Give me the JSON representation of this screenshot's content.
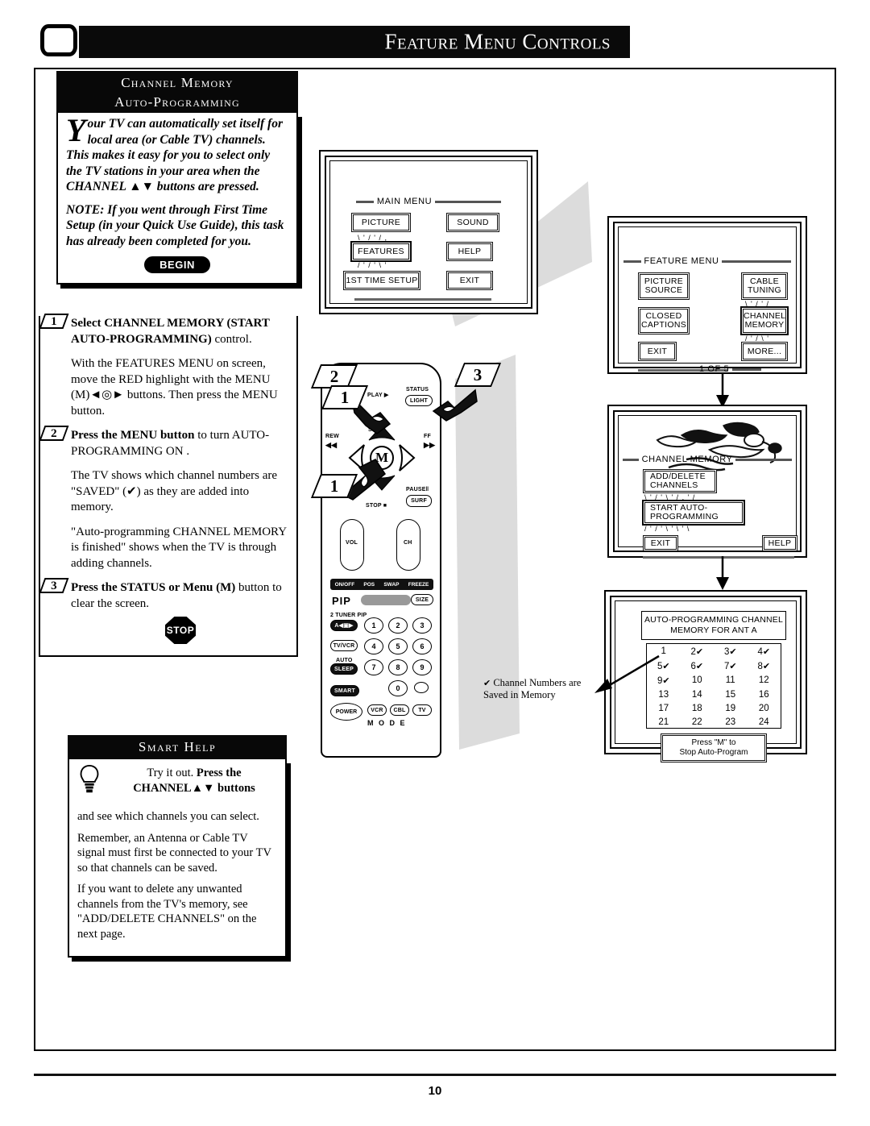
{
  "page": {
    "number": "10",
    "header_title": "Feature Menu Controls",
    "tv_icon": "tv-screen-icon"
  },
  "channel_memory_panel": {
    "heading_line1": "Channel Memory",
    "heading_line2": "Auto-Programming",
    "dropcap": "Y",
    "intro_paragraph": "our TV can automatically set itself for local area (or Cable TV) channels. This makes it easy for you to select only the TV stations in your area when the CHANNEL ▲▼ buttons are pressed.",
    "note_paragraph": "NOTE: If you went through First Time Setup (in your Quick Use Guide), this task has already been completed for you.",
    "begin_badge": "BEGIN"
  },
  "steps": [
    {
      "number": "1",
      "bold_text": "Select CHANNEL MEMORY (START AUTO-PROGRAMMING)",
      "rest_text": " control."
    },
    {
      "number": "2",
      "bold_text": "Press the MENU button",
      "rest_text": " to turn AUTO-PROGRAMMING ON ."
    },
    {
      "number": "3",
      "bold_text": "Press the STATUS or Menu (M)",
      "rest_text": " button to clear the screen."
    }
  ],
  "step_body": {
    "after_step1": "With the FEATURES MENU on screen, move the RED highlight  with the MENU (M)◄◎► buttons. Then press the MENU button.",
    "after_step2_a": "The TV shows which channel numbers are \"SAVED\" (✔) as they are added into memory.",
    "after_step2_b": "\"Auto-programming CHANNEL MEMORY is finished\" shows when the TV is through adding channels.",
    "stop_badge": "STOP"
  },
  "smart_help": {
    "heading": "Smart Help",
    "icon": "lightbulb-icon",
    "lead_normal": "Try it out. ",
    "lead_bold": "Press the CHANNEL▲▼ buttons",
    "paragraphs": [
      "and see which channels you can select.",
      "Remember, an Antenna or Cable TV signal must first be connected to your TV so that channels can be saved.",
      "If you want to delete any unwanted channels from the TV's memory, see \"ADD/DELETE CHANNELS\" on the next page."
    ]
  },
  "screens": {
    "main_menu": {
      "title": "MAIN MENU",
      "buttons": [
        {
          "label": "PICTURE",
          "highlighted": false
        },
        {
          "label": "SOUND",
          "highlighted": false
        },
        {
          "label": "FEATURES",
          "highlighted": true
        },
        {
          "label": "HELP",
          "highlighted": false
        },
        {
          "label": "1ST TIME SETUP",
          "highlighted": false
        },
        {
          "label": "EXIT",
          "highlighted": false
        }
      ]
    },
    "feature_menu": {
      "title": "FEATURE MENU",
      "buttons": [
        {
          "label": "PICTURE SOURCE",
          "highlighted": false
        },
        {
          "label": "CABLE TUNING",
          "highlighted": false
        },
        {
          "label": "CLOSED CAPTIONS",
          "highlighted": false
        },
        {
          "label": "CHANNEL MEMORY",
          "highlighted": true
        },
        {
          "label": "EXIT",
          "highlighted": false
        },
        {
          "label": "MORE...",
          "highlighted": false
        }
      ],
      "page_indicator": "1 OF 5"
    },
    "channel_memory": {
      "title": "CHANNEL MEMORY",
      "artwork": "swimmers-illustration",
      "buttons": [
        {
          "label": "ADD/DELETE CHANNELS",
          "highlighted": false
        },
        {
          "label": "START AUTO-PROGRAMMING",
          "highlighted": true
        },
        {
          "label": "EXIT",
          "highlighted": false
        },
        {
          "label": "HELP",
          "highlighted": false
        }
      ]
    },
    "auto_programming": {
      "heading_line1": "AUTO-PROGRAMMING CHANNEL",
      "heading_line2": "MEMORY FOR ANT A",
      "channels": [
        {
          "n": "1",
          "saved": false
        },
        {
          "n": "2",
          "saved": true
        },
        {
          "n": "3",
          "saved": true
        },
        {
          "n": "4",
          "saved": true
        },
        {
          "n": "5",
          "saved": true
        },
        {
          "n": "6",
          "saved": true
        },
        {
          "n": "7",
          "saved": true
        },
        {
          "n": "8",
          "saved": true
        },
        {
          "n": "9",
          "saved": true
        },
        {
          "n": "10",
          "saved": false
        },
        {
          "n": "11",
          "saved": false
        },
        {
          "n": "12",
          "saved": false
        },
        {
          "n": "13",
          "saved": false
        },
        {
          "n": "14",
          "saved": false
        },
        {
          "n": "15",
          "saved": false
        },
        {
          "n": "16",
          "saved": false
        },
        {
          "n": "17",
          "saved": false
        },
        {
          "n": "18",
          "saved": false
        },
        {
          "n": "19",
          "saved": false
        },
        {
          "n": "20",
          "saved": false
        },
        {
          "n": "21",
          "saved": false
        },
        {
          "n": "22",
          "saved": false
        },
        {
          "n": "23",
          "saved": false
        },
        {
          "n": "24",
          "saved": false
        }
      ],
      "footer_line1": "Press \"M\" to",
      "footer_line2": "Stop Auto-Program",
      "check_glyph": "✔"
    }
  },
  "callout": {
    "glyph": "✔",
    "line1": "Channel Numbers are",
    "line2": "Saved in Memory"
  },
  "remote": {
    "callout_numbers": [
      "1",
      "2",
      "3",
      "1"
    ],
    "labels": {
      "play": "PLAY ▶",
      "rew": "REW",
      "rew_glyph": "◀◀",
      "ff": "FF",
      "ff_glyph": "▶▶",
      "slow": "SLOW",
      "menu_m": "M",
      "stop": "STOP",
      "stop_glyph": "■",
      "pause": "PAUSE",
      "pause_glyph": "‖",
      "status": "STATUS",
      "light": "LIGHT",
      "surf": "SURF",
      "vol": "VOL",
      "ch": "CH",
      "pip": "PIP",
      "size": "SIZE",
      "tuner_pip": "2 TUNER PIP",
      "on_off": "ON/OFF",
      "pos": "POS",
      "swap": "SWAP",
      "freeze": "FREEZE",
      "tv_vcr": "TV/VCR",
      "auto": "AUTO",
      "sleep": "SLEEP",
      "smart": "SMART",
      "power": "POWER",
      "mode": "M O D E",
      "mode_keys": [
        "VCR",
        "CBL",
        "TV"
      ],
      "keypad": [
        "1",
        "2",
        "3",
        "4",
        "5",
        "6",
        "7",
        "8",
        "9",
        "0"
      ]
    }
  }
}
